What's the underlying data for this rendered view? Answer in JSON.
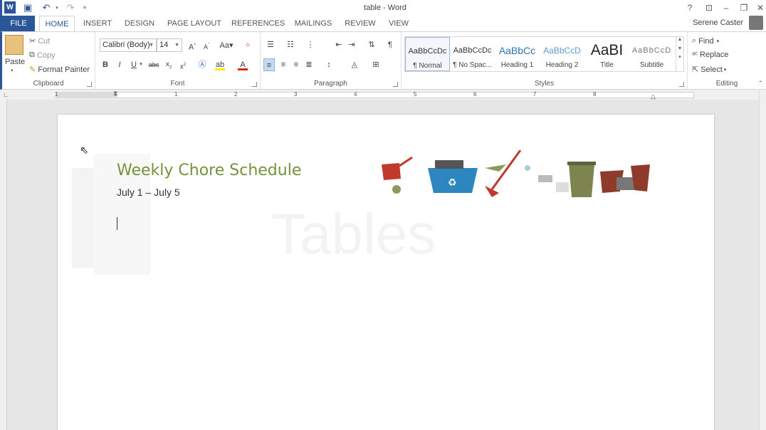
{
  "window": {
    "title": "table - Word"
  },
  "quick_access": {
    "undo_glyph": "↶",
    "redo_glyph": "↷"
  },
  "window_controls": {
    "help": "?",
    "display": "⊡",
    "min": "–",
    "restore": "❐",
    "close": "✕"
  },
  "tabs": [
    "FILE",
    "HOME",
    "INSERT",
    "DESIGN",
    "PAGE LAYOUT",
    "REFERENCES",
    "MAILINGS",
    "REVIEW",
    "VIEW"
  ],
  "user": {
    "name": "Serene Caster"
  },
  "clipboard": {
    "paste": "Paste",
    "cut": "Cut",
    "copy": "Copy",
    "format_painter": "Format Painter",
    "label": "Clipboard"
  },
  "font": {
    "name": "Calibri (Body)",
    "size": "14",
    "case": "Aa",
    "label": "Font"
  },
  "paragraph": {
    "label": "Paragraph"
  },
  "styles": {
    "label": "Styles",
    "items": [
      {
        "preview": "AaBbCcDc",
        "name": "¶ Normal",
        "color": "#333333"
      },
      {
        "preview": "AaBbCcDc",
        "name": "¶ No Spac...",
        "color": "#333333"
      },
      {
        "preview": "AaBbCc",
        "name": "Heading 1",
        "color": "#2e74b5"
      },
      {
        "preview": "AaBbCcD",
        "name": "Heading 2",
        "color": "#5b9bd5"
      },
      {
        "preview": "AaBI",
        "name": "Title",
        "color": "#222222"
      },
      {
        "preview": "AaBbCcD",
        "name": "Subtitle",
        "color": "#666666"
      }
    ]
  },
  "editing": {
    "find": "Find",
    "replace": "Replace",
    "select": "Select",
    "label": "Editing"
  },
  "ruler": {
    "numbers": [
      "1",
      "1",
      "2",
      "3",
      "4",
      "5",
      "6",
      "7",
      "8"
    ]
  },
  "document": {
    "heading": "Weekly Chore Schedule",
    "dates": "July 1 – July 5"
  },
  "watermark": {
    "text": "Tables"
  },
  "colors": {
    "accent": "#2b579a",
    "heading": "#76923c"
  }
}
